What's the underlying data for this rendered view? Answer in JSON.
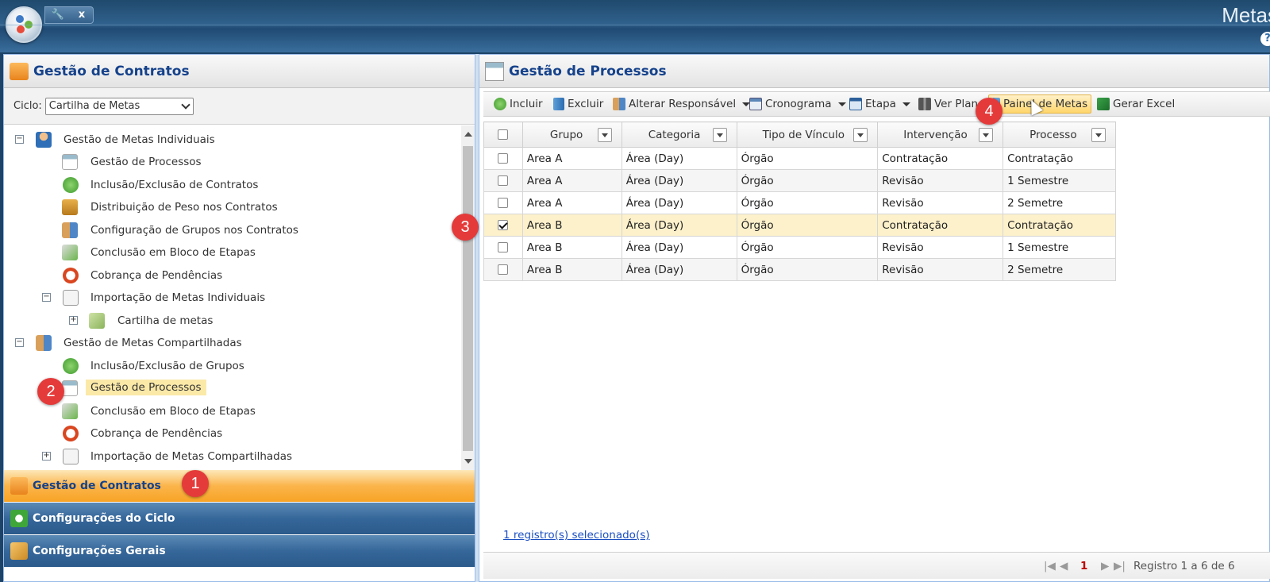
{
  "app": {
    "brand": "Metas",
    "help_icon": "?",
    "quick_close": "x"
  },
  "left_panel": {
    "title": "Gestão de Contratos",
    "ciclo_label": "Ciclo:",
    "ciclo_value": "Cartilha de Metas",
    "tree": [
      {
        "label": "Gestão de Metas Individuais",
        "toggle": "−",
        "icon": "user-icon"
      },
      {
        "label": "Gestão de Processos",
        "icon": "window-icon"
      },
      {
        "label": "Inclusão/Exclusão de Contratos",
        "icon": "plus-circle-icon"
      },
      {
        "label": "Distribuição de Peso nos Contratos",
        "icon": "scale-icon"
      },
      {
        "label": "Configuração de Grupos nos Contratos",
        "icon": "group-icon"
      },
      {
        "label": "Conclusão em Bloco de Etapas",
        "icon": "check-icon"
      },
      {
        "label": "Cobrança de Pendências",
        "icon": "clock-icon"
      },
      {
        "label": "Importação de Metas Individuais",
        "toggle": "−",
        "icon": "import-icon"
      },
      {
        "label": "Cartilha de metas",
        "toggle": "+",
        "icon": "book-icon"
      },
      {
        "label": "Gestão de Metas Compartilhadas",
        "toggle": "−",
        "icon": "group-icon"
      },
      {
        "label": "Inclusão/Exclusão de Grupos",
        "icon": "plus-circle-icon"
      },
      {
        "label": "Gestão de Processos",
        "icon": "window-icon"
      },
      {
        "label": "Conclusão em Bloco de Etapas",
        "icon": "check-icon"
      },
      {
        "label": "Cobrança de Pendências",
        "icon": "clock-icon"
      },
      {
        "label": "Importação de Metas Compartilhadas",
        "toggle": "+",
        "icon": "import-icon"
      }
    ],
    "accordion": [
      "Gestão de Contratos",
      "Configurações do Ciclo",
      "Configurações Gerais"
    ]
  },
  "right_panel": {
    "title": "Gestão de Processos",
    "toolbar": {
      "incluir": "Incluir",
      "excluir": "Excluir",
      "alterar": "Alterar Responsável",
      "cronograma": "Cronograma",
      "etapa": "Etapa",
      "ver_plano": "Ver Plano",
      "painel": "Painel de Metas",
      "excel": "Gerar Excel"
    },
    "columns": [
      "Grupo",
      "Categoria",
      "Tipo de Vínculo",
      "Intervenção",
      "Processo"
    ],
    "rows": [
      {
        "grupo": "Area A",
        "categoria": "Área (Day)",
        "tipo": "Órgão",
        "intervencao": "Contratação",
        "processo": "Contratação",
        "checked": false
      },
      {
        "grupo": "Area A",
        "categoria": "Área (Day)",
        "tipo": "Órgão",
        "intervencao": "Revisão",
        "processo": "1 Semestre",
        "checked": false
      },
      {
        "grupo": "Area A",
        "categoria": "Área (Day)",
        "tipo": "Órgão",
        "intervencao": "Revisão",
        "processo": "2 Semetre",
        "checked": false
      },
      {
        "grupo": "Area B",
        "categoria": "Área (Day)",
        "tipo": "Órgão",
        "intervencao": "Contratação",
        "processo": "Contratação",
        "checked": true
      },
      {
        "grupo": "Area B",
        "categoria": "Área (Day)",
        "tipo": "Órgão",
        "intervencao": "Revisão",
        "processo": "1 Semestre",
        "checked": false
      },
      {
        "grupo": "Area B",
        "categoria": "Área (Day)",
        "tipo": "Órgão",
        "intervencao": "Revisão",
        "processo": "2 Semetre",
        "checked": false
      }
    ],
    "selection_info": "1 registro(s) selecionado(s)",
    "pager": {
      "page": "1",
      "summary": "Registro 1 a 6 de 6"
    }
  },
  "badges": [
    "1",
    "2",
    "3",
    "4"
  ],
  "colors": {
    "accent": "#15428b",
    "highlight": "#fbb44b",
    "badge": "#e53a3a",
    "selected_row": "#fdf1cb"
  }
}
